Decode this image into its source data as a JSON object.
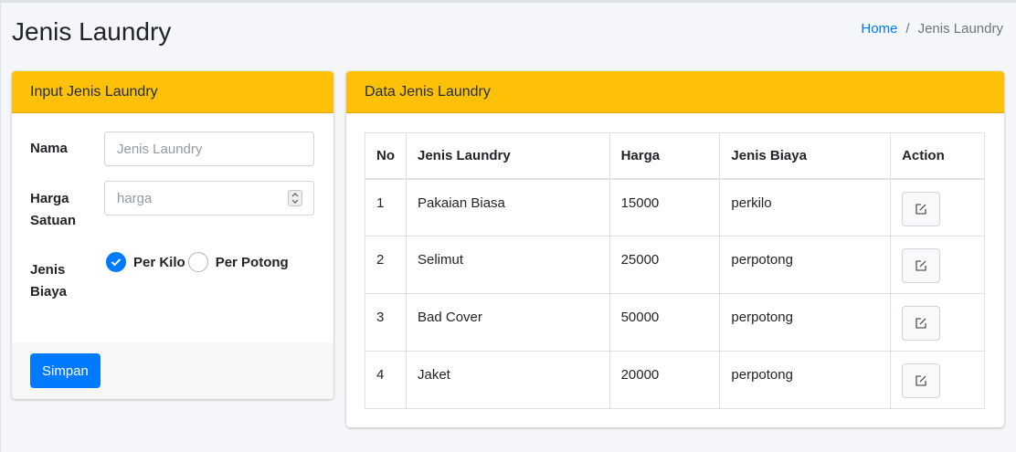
{
  "page": {
    "title": "Jenis Laundry"
  },
  "breadcrumb": {
    "home": "Home",
    "separator": "/",
    "current": "Jenis Laundry"
  },
  "input_card": {
    "header": "Input Jenis Laundry",
    "nama_label": "Nama",
    "nama_placeholder": "Jenis Laundry",
    "harga_label": "Harga Satuan",
    "harga_placeholder": "harga",
    "biaya_label": "Jenis Biaya",
    "options": [
      {
        "label": "Per Kilo",
        "checked": true
      },
      {
        "label": "Per Potong",
        "checked": false
      }
    ],
    "submit_label": "Simpan"
  },
  "data_card": {
    "header": "Data Jenis Laundry",
    "columns": [
      "No",
      "Jenis Laundry",
      "Harga",
      "Jenis Biaya",
      "Action"
    ],
    "rows": [
      {
        "no": "1",
        "jenis": "Pakaian Biasa",
        "harga": "15000",
        "biaya": "perkilo"
      },
      {
        "no": "2",
        "jenis": "Selimut",
        "harga": "25000",
        "biaya": "perpotong"
      },
      {
        "no": "3",
        "jenis": "Bad Cover",
        "harga": "50000",
        "biaya": "perpotong"
      },
      {
        "no": "4",
        "jenis": "Jaket",
        "harga": "20000",
        "biaya": "perpotong"
      }
    ],
    "action_icon": "edit-icon"
  },
  "colors": {
    "card_header": "#ffc107",
    "primary": "#007bff",
    "link": "#007bff",
    "background": "#f4f6f9"
  }
}
